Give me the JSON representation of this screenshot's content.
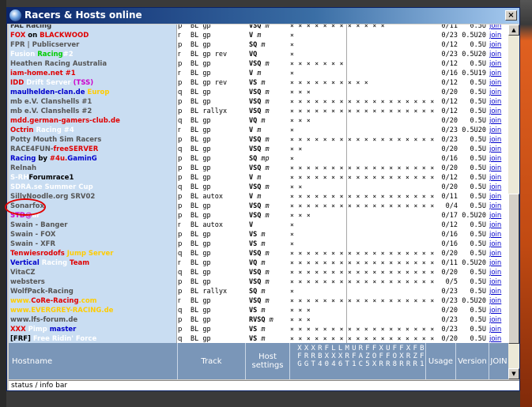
{
  "window": {
    "title": "Racers & Hosts online",
    "close_label": "×"
  },
  "columns": {
    "hostname": "Hostname",
    "track": "Track",
    "host_settings": "Host settings",
    "usage": "Usage",
    "version": "Version",
    "join": "JOIN",
    "cars_top": [
      "X",
      "X",
      "X",
      "R",
      "F",
      "L",
      "L",
      "M",
      "U",
      "R",
      "F",
      "F",
      "X",
      "U",
      "F",
      "F",
      "X",
      "F",
      "B"
    ],
    "cars_mid": [
      "F",
      "R",
      "R",
      "B",
      "X",
      "X",
      "X",
      "R",
      "F",
      "A",
      "Z",
      "O",
      "F",
      "F",
      "O",
      "X",
      "R",
      "Z",
      "F"
    ],
    "cars_bot": [
      "G",
      "G",
      "T",
      "4",
      "0",
      "4",
      "6",
      "T",
      "1",
      "C",
      "5",
      "X",
      "R",
      "R",
      "8",
      "R",
      "R",
      "R",
      "1"
    ]
  },
  "rows": [
    {
      "name": [
        {
          "t": "FAL Racing",
          "c": "#333"
        }
      ],
      "ty": "p",
      "track": "BL gp",
      "hs": "VSQ",
      "hs2": "m",
      "cars": "× × × × × × × × × × × ×",
      "use": "0/11",
      "ver": "0.5U",
      "join": "join"
    },
    {
      "name": [
        {
          "t": "FOX",
          "c": "#e00000"
        },
        {
          "t": " on ",
          "c": "#000"
        },
        {
          "t": "BLACKWOOD",
          "c": "#e00000"
        }
      ],
      "ty": "r",
      "track": "BL gp",
      "hs": "V",
      "hs2": "m",
      "cars": "              ×",
      "use": "0/23",
      "ver": "0.5U20",
      "join": "join"
    },
    {
      "name": [
        {
          "t": "FPR | Publicserver",
          "c": "#555"
        }
      ],
      "ty": "p",
      "track": "BL gp",
      "hs": "SQ",
      "hs2": "m",
      "cars": "              ×",
      "use": "0/12",
      "ver": "0.5U",
      "join": "join"
    },
    {
      "name": [
        {
          "t": "Fusion ",
          "c": "#ffffff"
        },
        {
          "t": "Racing",
          "c": "#00cc00"
        },
        {
          "t": "#2",
          "c": "#ffffff"
        }
      ],
      "ty": "r",
      "track": "BL gp rev",
      "hs": "VQ",
      "hs2": "",
      "cars": "              ×",
      "use": "0/23",
      "ver": "0.5U20",
      "join": "join"
    },
    {
      "name": [
        {
          "t": "Heathen Racing Australia",
          "c": "#555"
        }
      ],
      "ty": "p",
      "track": "BL gp",
      "hs": "VSQ",
      "hs2": "m",
      "cars": "             × × × × × × ×",
      "use": "0/12",
      "ver": "0.5U",
      "join": "join"
    },
    {
      "name": [
        {
          "t": "iam-home.net #1",
          "c": "#e00000"
        }
      ],
      "ty": "r",
      "track": "BL gp",
      "hs": "V",
      "hs2": "m",
      "cars": "              ×",
      "use": "0/16",
      "ver": "0.5U19",
      "join": "join"
    },
    {
      "name": [
        {
          "t": "IDD",
          "c": "#e00000"
        },
        {
          "t": " Drift Server ",
          "c": "#ffffff"
        },
        {
          "t": "(TSS)",
          "c": "#cc00cc"
        }
      ],
      "ty": "p",
      "track": "BL gp rev",
      "hs": "VS",
      "hs2": "m",
      "cars": "  × × ×  × × ×  × ×      × ×",
      "use": "0/12",
      "ver": "0.5U",
      "join": "join"
    },
    {
      "name": [
        {
          "t": "maulhelden-clan.de",
          "c": "#0000cc"
        },
        {
          "t": " Europ",
          "c": "#ffcc00"
        }
      ],
      "ty": "q",
      "track": "BL gp",
      "hs": "VSQ",
      "hs2": "m",
      "cars": "                    × × ×",
      "use": "0/20",
      "ver": "0.5U",
      "join": "join"
    },
    {
      "name": [
        {
          "t": "mb e.V. Clanshells #1",
          "c": "#555"
        }
      ],
      "ty": "p",
      "track": "BL gp",
      "hs": "VSQ",
      "hs2": "m",
      "cars": "× × × × × × × × × × × × × × × × × ×",
      "use": "0/12",
      "ver": "0.5U",
      "join": "join"
    },
    {
      "name": [
        {
          "t": "mb e.V. Clanshells #2",
          "c": "#555"
        }
      ],
      "ty": "p",
      "track": "BL rallyx",
      "hs": "VSQ",
      "hs2": "m",
      "cars": "× × × × × × × × × × × × × × × × × ×",
      "use": "0/12",
      "ver": "0.5U",
      "join": "join"
    },
    {
      "name": [
        {
          "t": "mdd.german-gamers-club.de",
          "c": "#e00000"
        }
      ],
      "ty": "q",
      "track": "BL gp",
      "hs": "VQ",
      "hs2": "m",
      "cars": "        ×  × ×",
      "use": "0/20",
      "ver": "0.5U",
      "join": "join"
    },
    {
      "name": [
        {
          "t": "Octrin",
          "c": "#e00000"
        },
        {
          "t": " Racing #4",
          "c": "#ffffff"
        }
      ],
      "ty": "r",
      "track": "BL gp",
      "hs": "V",
      "hs2": "m",
      "cars": "              ×",
      "use": "0/23",
      "ver": "0.5U20",
      "join": "join"
    },
    {
      "name": [
        {
          "t": "Potty Mouth Sim Racers",
          "c": "#555"
        }
      ],
      "ty": "p",
      "track": "BL gp",
      "hs": "VSQ",
      "hs2": "m",
      "cars": "× × × × × × × × × × × × × × × × × ×",
      "use": "0/23",
      "ver": "0.5U",
      "join": "join"
    },
    {
      "name": [
        {
          "t": "RACE4FUN-",
          "c": "#555"
        },
        {
          "t": "freeSERVER",
          "c": "#e00000"
        }
      ],
      "ty": "q",
      "track": "BL gp",
      "hs": "VSQ",
      "hs2": "m",
      "cars": "                × ×",
      "use": "0/20",
      "ver": "0.5U",
      "join": "join"
    },
    {
      "name": [
        {
          "t": "Racing",
          "c": "#0000cc"
        },
        {
          "t": " by ",
          "c": "#000"
        },
        {
          "t": "#4u.",
          "c": "#e00000"
        },
        {
          "t": "GaminG",
          "c": "#0000cc"
        }
      ],
      "ty": "p",
      "track": "BL gp",
      "hs": "SQ",
      "hs2": "mp",
      "cars": "              ×",
      "use": "0/16",
      "ver": "0.5U",
      "join": "join"
    },
    {
      "name": [
        {
          "t": "Relnah",
          "c": "#555"
        }
      ],
      "ty": "p",
      "track": "BL gp",
      "hs": "VSQ",
      "hs2": "m",
      "cars": "× × × × × × × × × × × × × × × × × ×",
      "use": "0/20",
      "ver": "0.5U",
      "join": "join"
    },
    {
      "name": [
        {
          "t": "S-RH",
          "c": "#ffffff"
        },
        {
          "t": "Forumrace1",
          "c": "#000"
        }
      ],
      "ty": "p",
      "track": "BL gp",
      "hs": "V",
      "hs2": "m",
      "cars": "× × × × × × × × × × × × × × × × × ×",
      "use": "0/12",
      "ver": "0.5U",
      "join": "join"
    },
    {
      "name": [
        {
          "t": "SDRA.se",
          "c": "#ffffff"
        },
        {
          "t": " Summer Cup",
          "c": "#ffffff"
        }
      ],
      "ty": "q",
      "track": "BL gp",
      "hs": "VSQ",
      "hs2": "m",
      "cars": "× ×",
      "use": "0/20",
      "ver": "0.5U",
      "join": "join"
    },
    {
      "name": [
        {
          "t": "SillyNoodle.org SRV02",
          "c": "#555"
        }
      ],
      "ty": "p",
      "track": "BL autox",
      "hs": "V",
      "hs2": "m",
      "cars": "× × × × × × × × × × × × × × × × × ×",
      "use": "0/11",
      "ver": "0.5U",
      "join": "join"
    },
    {
      "name": [
        {
          "t": "Sonarfox",
          "c": "#555"
        }
      ],
      "ty": "p",
      "track": "BL gp",
      "hs": "VSQ",
      "hs2": "m",
      "cars": "× × × × × × × × × × × × × × × × × ×",
      "use": "0/4",
      "ver": "0.5U",
      "join": "join"
    },
    {
      "name": [
        {
          "t": "STD@",
          "c": "#cc00cc"
        },
        {
          "t": "ar",
          "c": "#ffffff"
        }
      ],
      "ty": "p",
      "track": "BL gp",
      "hs": "VSQ",
      "hs2": "m",
      "cars": "× ×           ×",
      "use": "0/17",
      "ver": "0.5U20",
      "join": "join"
    },
    {
      "name": [
        {
          "t": "Swain - Banger",
          "c": "#555"
        }
      ],
      "ty": "r",
      "track": "BL autox",
      "hs": "V",
      "hs2": "",
      "cars": "              ×",
      "use": "0/12",
      "ver": "0.5U",
      "join": "join"
    },
    {
      "name": [
        {
          "t": "Swain - FOX",
          "c": "#555"
        }
      ],
      "ty": "p",
      "track": "BL gp",
      "hs": "VS",
      "hs2": "m",
      "cars": "              ×",
      "use": "0/16",
      "ver": "0.5U",
      "join": "join"
    },
    {
      "name": [
        {
          "t": "Swain - XFR",
          "c": "#555"
        }
      ],
      "ty": "p",
      "track": "BL gp",
      "hs": "VS",
      "hs2": "m",
      "cars": "              ×",
      "use": "0/16",
      "ver": "0.5U",
      "join": "join"
    },
    {
      "name": [
        {
          "t": "Tenwiesrodofs",
          "c": "#e00000"
        },
        {
          "t": " Jump Server",
          "c": "#ffcc00"
        }
      ],
      "ty": "q",
      "track": "BL gp",
      "hs": "VSQ",
      "hs2": "m",
      "cars": "× × × × × × × × × × × × × × × × × ×",
      "use": "0/20",
      "ver": "0.5U",
      "join": "join"
    },
    {
      "name": [
        {
          "t": "Vertical",
          "c": "#0000cc"
        },
        {
          "t": " Racing ",
          "c": "#ffffff"
        },
        {
          "t": "Team",
          "c": "#e00000"
        }
      ],
      "ty": "r",
      "track": "BL gp",
      "hs": "VQ",
      "hs2": "m",
      "cars": "× × × × × × × × × × × × × × × × × ×",
      "use": "0/11",
      "ver": "0.5U20",
      "join": "join"
    },
    {
      "name": [
        {
          "t": "VitaCZ",
          "c": "#555"
        }
      ],
      "ty": "q",
      "track": "BL gp",
      "hs": "VSQ",
      "hs2": "m",
      "cars": "× × × × × × × × × × × × × × × × × ×",
      "use": "0/20",
      "ver": "0.5U",
      "join": "join"
    },
    {
      "name": [
        {
          "t": "websters",
          "c": "#555"
        }
      ],
      "ty": "p",
      "track": "BL gp",
      "hs": "VSQ",
      "hs2": "m",
      "cars": "× × × × × × × × × × × × × × × × × ×",
      "use": "0/5",
      "ver": "0.5U",
      "join": "join"
    },
    {
      "name": [
        {
          "t": "WolfPack-Racing",
          "c": "#555"
        }
      ],
      "ty": "p",
      "track": "BL rallyx",
      "hs": "SQ",
      "hs2": "m",
      "cars": "    ×",
      "use": "0/23",
      "ver": "0.5U",
      "join": "join"
    },
    {
      "name": [
        {
          "t": "www.",
          "c": "#ffcc00"
        },
        {
          "t": "CoRe-Racing",
          "c": "#e00000"
        },
        {
          "t": ".com",
          "c": "#ffcc00"
        }
      ],
      "ty": "r",
      "track": "BL gp",
      "hs": "VSQ",
      "hs2": "m",
      "cars": "× × × × × × × × × × × × × × × × × ×",
      "use": "0/23",
      "ver": "0.5U20",
      "join": "join"
    },
    {
      "name": [
        {
          "t": "www.",
          "c": "#ffcc00"
        },
        {
          "t": "EVERGREY-RACING.de",
          "c": "#ffcc00"
        }
      ],
      "ty": "q",
      "track": "BL gp",
      "hs": "VS",
      "hs2": "m",
      "cars": "                    × × ×",
      "use": "0/20",
      "ver": "0.5U",
      "join": "join"
    },
    {
      "name": [
        {
          "t": "www.",
          "c": "#555"
        },
        {
          "t": "lfs-forum.de",
          "c": "#555"
        }
      ],
      "ty": "p",
      "track": "BL gp",
      "hs": "RVSQ",
      "hs2": "m",
      "cars": "                    × × ×",
      "use": "0/23",
      "ver": "0.5U",
      "join": "join"
    },
    {
      "name": [
        {
          "t": "XXX",
          "c": "#e00000"
        },
        {
          "t": " Pimp ",
          "c": "#ffffff"
        },
        {
          "t": "master",
          "c": "#0000cc"
        }
      ],
      "ty": "p",
      "track": "BL gp",
      "hs": "VS",
      "hs2": "m",
      "cars": "× × × × × × × × × × × × × × × × × ×",
      "use": "0/23",
      "ver": "0.5U",
      "join": "join"
    },
    {
      "name": [
        {
          "t": "[FRF]",
          "c": "#000"
        },
        {
          "t": " Free Ridin' Force",
          "c": "#ffffff"
        }
      ],
      "ty": "q",
      "track": "BL gp",
      "hs": "VS",
      "hs2": "m",
      "cars": "× × × × × × × × × × × × × × × × × ×",
      "use": "0/20",
      "ver": "0.5U",
      "join": "join"
    }
  ],
  "status_bar": "status / info bar",
  "scroll": {
    "up": "▲",
    "down": "▼"
  }
}
